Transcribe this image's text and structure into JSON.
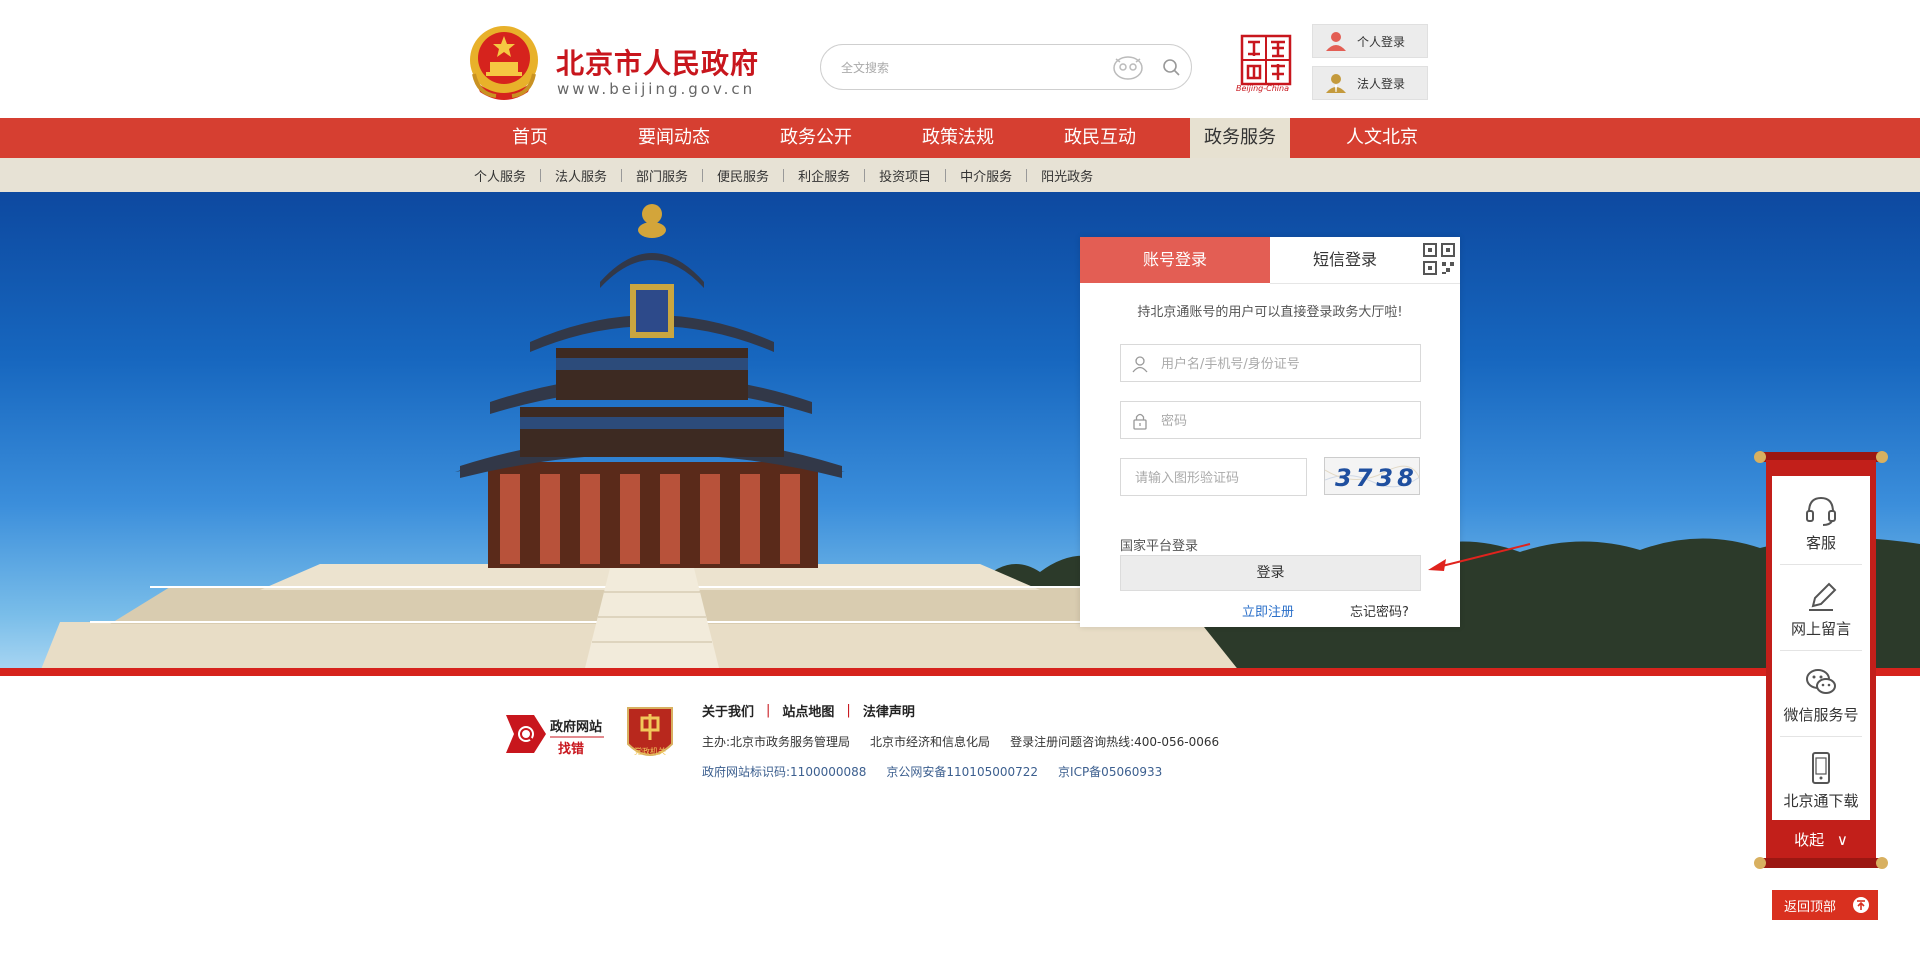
{
  "header": {
    "title": "北京市人民政府",
    "url": "www.beijing.gov.cn",
    "search_placeholder": "全文搜索",
    "seal_caption": "Beijing-China",
    "personal_login": "个人登录",
    "corporate_login": "法人登录"
  },
  "nav": {
    "items": [
      {
        "label": "首页",
        "active": false
      },
      {
        "label": "要闻动态",
        "active": false
      },
      {
        "label": "政务公开",
        "active": false
      },
      {
        "label": "政策法规",
        "active": false
      },
      {
        "label": "政民互动",
        "active": false
      },
      {
        "label": "政务服务",
        "active": true
      },
      {
        "label": "人文北京",
        "active": false
      }
    ]
  },
  "subnav": {
    "items": [
      "个人服务",
      "法人服务",
      "部门服务",
      "便民服务",
      "利企服务",
      "投资项目",
      "中介服务",
      "阳光政务"
    ]
  },
  "login": {
    "tab_account": "账号登录",
    "tab_sms": "短信登录",
    "tip": "持北京通账号的用户可以直接登录政务大厅啦!",
    "username_placeholder": "用户名/手机号/身份证号",
    "password_placeholder": "密码",
    "captcha_placeholder": "请输入图形验证码",
    "captcha_text": "3738",
    "national_label": "国家平台登录",
    "submit_label": "登录",
    "register_label": "立即注册",
    "forgot_label": "忘记密码?"
  },
  "footer": {
    "badge1_line1": "政府网站",
    "badge1_line2": "找错",
    "badge2_text": "党政机关",
    "links": [
      "关于我们",
      "站点地图",
      "法律声明"
    ],
    "line1": [
      "主办:北京市政务服务管理局",
      "北京市经济和信息化局",
      "登录注册问题咨询热线:400-056-0066"
    ],
    "line2": [
      "政府网站标识码:1100000088",
      "京公网安备110105000722",
      "京ICP备05060933"
    ]
  },
  "float_bar": {
    "items": [
      "客服",
      "网上留言",
      "微信服务号",
      "北京通下载"
    ],
    "collapse_label": "收起",
    "back_top_label": "返回顶部"
  },
  "colors": {
    "brand_red": "#d63f31",
    "tab_red": "#e35e54",
    "nav_active_bg": "#e7e1d1",
    "link_blue": "#2a6fc9"
  }
}
